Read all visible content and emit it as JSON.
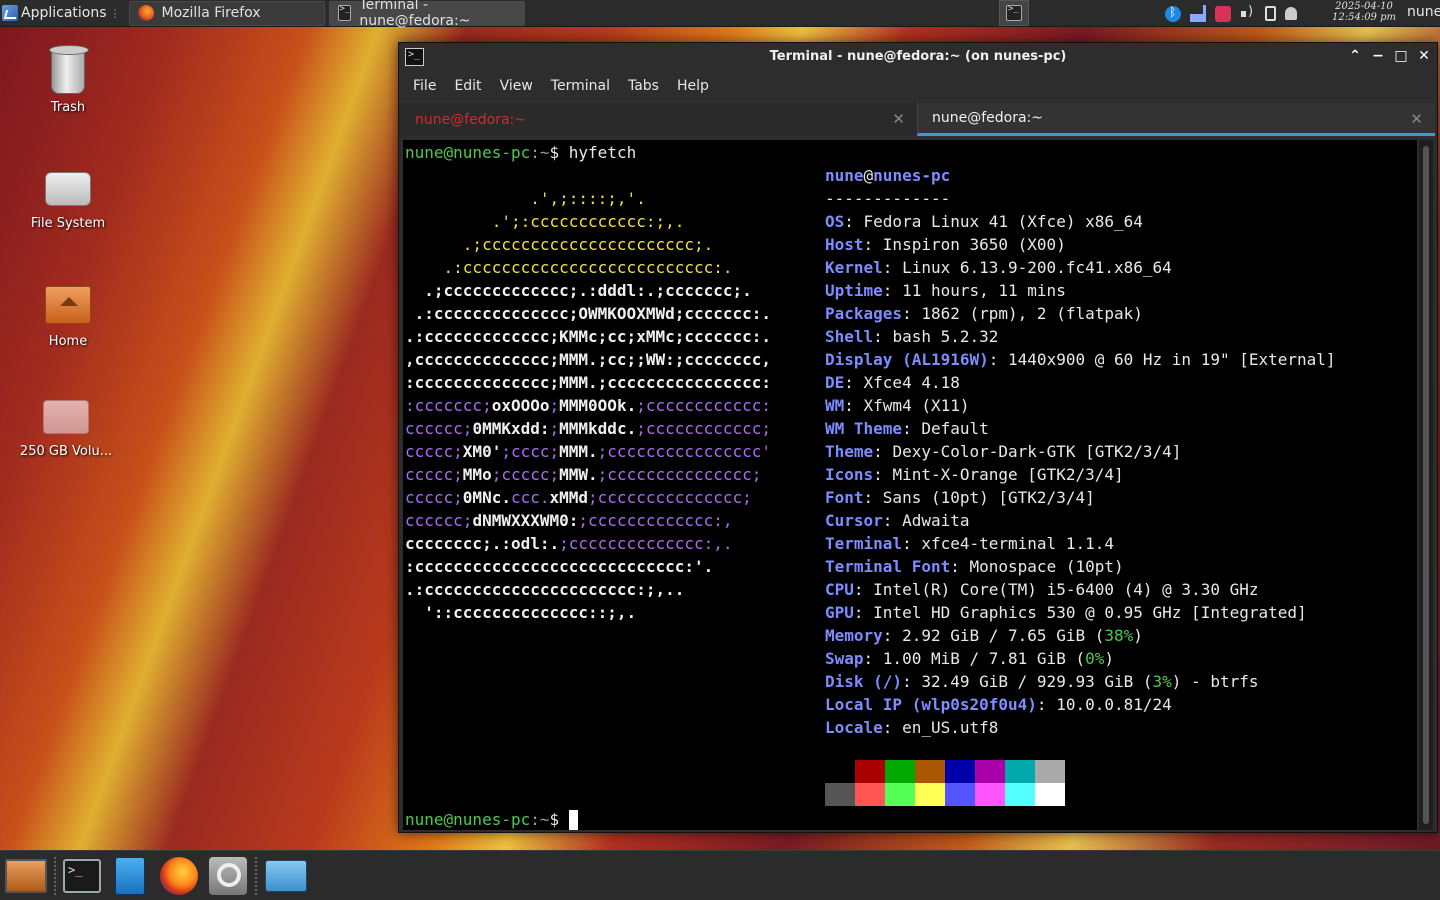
{
  "top_panel": {
    "applications_label": "Applications",
    "tasks": [
      {
        "label": "Mozilla Firefox",
        "icon": "firefox-icon"
      },
      {
        "label": "Terminal - nune@fedora:~",
        "icon": "terminal-icon"
      }
    ],
    "clock_date": "2025-04-10",
    "clock_time": "12:54:09 pm",
    "user": "nune"
  },
  "desktop_icons": [
    {
      "label": "Trash",
      "icon": "trash-icon"
    },
    {
      "label": "File System",
      "icon": "drive-icon"
    },
    {
      "label": "Home",
      "icon": "home-folder-icon"
    },
    {
      "label": "250 GB Volu...",
      "icon": "usb-drive-icon"
    }
  ],
  "window": {
    "title": "Terminal - nune@fedora:~ (on nunes-pc)",
    "menu": [
      "File",
      "Edit",
      "View",
      "Terminal",
      "Tabs",
      "Help"
    ],
    "tabs": [
      {
        "label": "nune@fedora:~",
        "active": false
      },
      {
        "label": "nune@fedora:~",
        "active": true
      }
    ]
  },
  "terminal": {
    "prompt_user": "nune@nunes-pc",
    "prompt_sep": ":~",
    "prompt_symbol": "$",
    "command": "hyfetch",
    "art": [
      [
        [
          "y",
          "             .',;::::;,'."
        ]
      ],
      [
        [
          "y",
          "         .';:cccccccccccc:;,."
        ]
      ],
      [
        [
          "y",
          "      .;cccccccccccccccccccccc;."
        ]
      ],
      [
        [
          "y",
          "    .:cccccccccccccccccccccccccc:."
        ]
      ],
      [
        [
          "w",
          "  .;ccccccccccccc;.:dddl:.;ccccccc;."
        ]
      ],
      [
        [
          "w",
          " .:cccccccccccccc;OWMKOOXMWd;ccccccc:."
        ]
      ],
      [
        [
          "w",
          ".:ccccccccccccc;KMMc;cc;xMMc;ccccccc:."
        ]
      ],
      [
        [
          "w",
          ",cccccccccccccc;MMM.;cc;;WW:;cccccccc,"
        ]
      ],
      [
        [
          "w",
          ":cccccccccccccc;MMM.;cccccccccccccccc:"
        ]
      ],
      [
        [
          "p",
          ":ccccccc;"
        ],
        [
          "w",
          "oxOOOo"
        ],
        [
          "p",
          ";"
        ],
        [
          "w",
          "MMM0OOk."
        ],
        [
          "p",
          ";cccccccccccc:"
        ]
      ],
      [
        [
          "p",
          "cccccc;"
        ],
        [
          "w",
          "0MMKxdd:"
        ],
        [
          "p",
          ";"
        ],
        [
          "w",
          "MMMkddc."
        ],
        [
          "p",
          ";cccccccccccc;"
        ]
      ],
      [
        [
          "p",
          "ccccc;"
        ],
        [
          "w",
          "XM0'"
        ],
        [
          "p",
          ";cccc;"
        ],
        [
          "w",
          "MMM."
        ],
        [
          "p",
          ";cccccccccccccccc'"
        ]
      ],
      [
        [
          "p",
          "ccccc;"
        ],
        [
          "w",
          "MMo"
        ],
        [
          "p",
          ";ccccc;"
        ],
        [
          "w",
          "MMW."
        ],
        [
          "p",
          ";ccccccccccccccc;"
        ]
      ],
      [
        [
          "p",
          "ccccc;"
        ],
        [
          "w",
          "0MNc."
        ],
        [
          "p",
          "ccc."
        ],
        [
          "w",
          "xMMd"
        ],
        [
          "p",
          ";ccccccccccccccc;"
        ]
      ],
      [
        [
          "p",
          "cccccc;"
        ],
        [
          "w",
          "dNMWXXXWM0:"
        ],
        [
          "p",
          ";ccccccccccccc:,"
        ]
      ],
      [
        [
          "w",
          "cccccccc;.:odl:."
        ],
        [
          "p",
          ";cccccccccccccc:,."
        ]
      ],
      [
        [
          "w",
          ":cccccccccccccccccccccccccccc:'."
        ]
      ],
      [
        [
          "w",
          ".:cccccccccccccccccccccc:;,.."
        ]
      ],
      [
        [
          "w",
          "  '::cccccccccccccc::;,."
        ]
      ]
    ],
    "info_header_user": "nune",
    "info_header_at": "@",
    "info_header_host": "nunes-pc",
    "info_separator": "-------------",
    "info": [
      {
        "key": "OS",
        "value": "Fedora Linux 41 (Xfce) x86_64"
      },
      {
        "key": "Host",
        "value": "Inspiron 3650 (X00)"
      },
      {
        "key": "Kernel",
        "value": "Linux 6.13.9-200.fc41.x86_64"
      },
      {
        "key": "Uptime",
        "value": "11 hours, 11 mins"
      },
      {
        "key": "Packages",
        "value": "1862 (rpm), 2 (flatpak)"
      },
      {
        "key": "Shell",
        "value": "bash 5.2.32"
      },
      {
        "key": "Display (AL1916W)",
        "value": "1440x900 @ 60 Hz in 19\" [External]"
      },
      {
        "key": "DE",
        "value": "Xfce4 4.18"
      },
      {
        "key": "WM",
        "value": "Xfwm4 (X11)"
      },
      {
        "key": "WM Theme",
        "value": "Default"
      },
      {
        "key": "Theme",
        "value": "Dexy-Color-Dark-GTK [GTK2/3/4]"
      },
      {
        "key": "Icons",
        "value": "Mint-X-Orange [GTK2/3/4]"
      },
      {
        "key": "Font",
        "value": "Sans (10pt) [GTK2/3/4]"
      },
      {
        "key": "Cursor",
        "value": "Adwaita"
      },
      {
        "key": "Terminal",
        "value": "xfce4-terminal 1.1.4"
      },
      {
        "key": "Terminal Font",
        "value": "Monospace (10pt)"
      },
      {
        "key": "CPU",
        "value": "Intel(R) Core(TM) i5-6400 (4) @ 3.30 GHz"
      },
      {
        "key": "GPU",
        "value": "Intel HD Graphics 530 @ 0.95 GHz [Integrated]"
      },
      {
        "key": "Memory",
        "value": "2.92 GiB / 7.65 GiB (",
        "pct": "38%",
        "tail": ")"
      },
      {
        "key": "Swap",
        "value": "1.00 MiB / 7.81 GiB (",
        "pct": "0%",
        "tail": ")"
      },
      {
        "key": "Disk (/)",
        "value": "32.49 GiB / 929.93 GiB (",
        "pct": "3%",
        "tail": ") - btrfs"
      },
      {
        "key": "Local IP (wlp0s20f0u4)",
        "value": "10.0.0.81/24"
      },
      {
        "key": "Locale",
        "value": "en_US.utf8"
      }
    ],
    "palette_top": [
      "#000000",
      "#aa0000",
      "#00aa00",
      "#aa5500",
      "#0000aa",
      "#aa00aa",
      "#00aaaa",
      "#aaaaaa"
    ],
    "palette_bottom": [
      "#555555",
      "#ff5555",
      "#55ff55",
      "#ffff55",
      "#5555ff",
      "#ff55ff",
      "#55ffff",
      "#ffffff"
    ]
  },
  "dock": [
    {
      "name": "show-desktop",
      "icon": "desktop-icon"
    },
    {
      "name": "terminal",
      "icon": "terminal-icon"
    },
    {
      "name": "file-manager",
      "icon": "files-icon"
    },
    {
      "name": "firefox",
      "icon": "firefox-icon"
    },
    {
      "name": "app-finder",
      "icon": "search-icon"
    },
    {
      "name": "folder",
      "icon": "folder-icon"
    }
  ]
}
